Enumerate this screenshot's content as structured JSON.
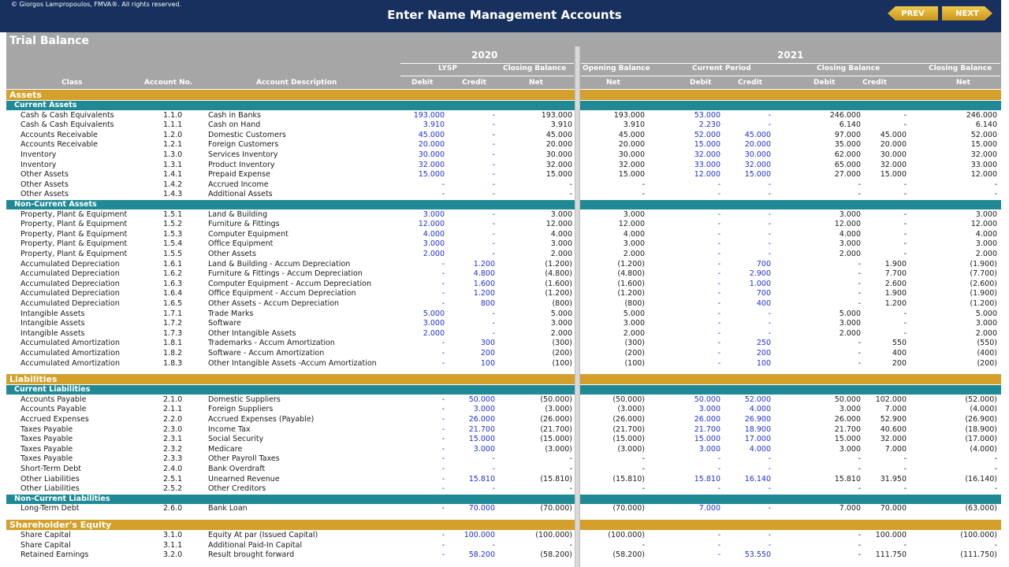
{
  "header": {
    "copyright": "© Giorgos Lampropoulos, FMVA®. All rights reserved.",
    "title": "Enter Name Management Accounts",
    "prev_label": "PREV",
    "next_label": "NEXT"
  },
  "sheet": {
    "title": "Trial Balance",
    "year_2020": "2020",
    "year_2021": "2021",
    "groups": {
      "lysp": "LYSP",
      "closing_2020": "Closing Balance",
      "opening": "Opening Balance",
      "current": "Current Period",
      "closing_2021": "Closing Balance",
      "closing_2021_net": "Closing Balance"
    },
    "columns": {
      "class": "Class",
      "account_no": "Account No.",
      "description": "Account Description",
      "debit": "Debit",
      "credit": "Credit",
      "net": "Net"
    }
  },
  "colors": {
    "navy": "#17305e",
    "gold": "#d4a02b",
    "teal": "#1f8a96",
    "grey": "#a6a6a6",
    "input_blue": "#1f2fd6"
  },
  "rows": [
    {
      "type": "section",
      "label": "Assets"
    },
    {
      "type": "sub",
      "label": "Current Assets"
    },
    {
      "cls": "Cash & Cash Equivalents",
      "no": "1.1.0",
      "desc": "Cash in Banks",
      "v": [
        "193.000",
        "-",
        "193.000",
        "193.000",
        "53.000",
        "-",
        "246.000",
        "-",
        "246.000"
      ]
    },
    {
      "cls": "Cash & Cash Equivalents",
      "no": "1.1.1",
      "desc": "Cash on Hand",
      "v": [
        "3.910",
        "-",
        "3.910",
        "3.910",
        "2.230",
        "-",
        "6.140",
        "-",
        "6.140"
      ]
    },
    {
      "cls": "Accounts Receivable",
      "no": "1.2.0",
      "desc": "Domestic Customers",
      "v": [
        "45.000",
        "-",
        "45.000",
        "45.000",
        "52.000",
        "45.000",
        "97.000",
        "45.000",
        "52.000"
      ]
    },
    {
      "cls": "Accounts Receivable",
      "no": "1.2.1",
      "desc": "Foreign Customers",
      "v": [
        "20.000",
        "-",
        "20.000",
        "20.000",
        "15.000",
        "20.000",
        "35.000",
        "20.000",
        "15.000"
      ]
    },
    {
      "cls": "Inventory",
      "no": "1.3.0",
      "desc": "Services Inventory",
      "v": [
        "30.000",
        "-",
        "30.000",
        "30.000",
        "32.000",
        "30.000",
        "62.000",
        "30.000",
        "32.000"
      ]
    },
    {
      "cls": "Inventory",
      "no": "1.3.1",
      "desc": "Product Inventory",
      "v": [
        "32.000",
        "-",
        "32.000",
        "32.000",
        "33.000",
        "32.000",
        "65.000",
        "32.000",
        "33.000"
      ]
    },
    {
      "cls": "Other Assets",
      "no": "1.4.1",
      "desc": "Prepaid Expense",
      "v": [
        "15.000",
        "-",
        "15.000",
        "15.000",
        "12.000",
        "15.000",
        "27.000",
        "15.000",
        "12.000"
      ]
    },
    {
      "cls": "Other Assets",
      "no": "1.4.2",
      "desc": "Accrued Income",
      "v": [
        "-",
        "-",
        "-",
        "-",
        "-",
        "-",
        "-",
        "-",
        "-"
      ]
    },
    {
      "cls": "Other Assets",
      "no": "1.4.3",
      "desc": "Additional Assets",
      "v": [
        "-",
        "-",
        "-",
        "-",
        "-",
        "-",
        "-",
        "-",
        "-"
      ]
    },
    {
      "type": "sub",
      "label": "Non-Current Assets"
    },
    {
      "cls": "Property, Plant & Equipment",
      "no": "1.5.1",
      "desc": "Land & Building",
      "v": [
        "3.000",
        "-",
        "3.000",
        "3.000",
        "-",
        "-",
        "3.000",
        "-",
        "3.000"
      ]
    },
    {
      "cls": "Property, Plant & Equipment",
      "no": "1.5.2",
      "desc": "Furniture & Fittings",
      "v": [
        "12.000",
        "-",
        "12.000",
        "12.000",
        "-",
        "-",
        "12.000",
        "-",
        "12.000"
      ]
    },
    {
      "cls": "Property, Plant & Equipment",
      "no": "1.5.3",
      "desc": "Computer Equipment",
      "v": [
        "4.000",
        "-",
        "4.000",
        "4.000",
        "-",
        "-",
        "4.000",
        "-",
        "4.000"
      ]
    },
    {
      "cls": "Property, Plant & Equipment",
      "no": "1.5.4",
      "desc": "Office Equipment",
      "v": [
        "3.000",
        "-",
        "3.000",
        "3.000",
        "-",
        "-",
        "3.000",
        "-",
        "3.000"
      ]
    },
    {
      "cls": "Property, Plant & Equipment",
      "no": "1.5.5",
      "desc": "Other Assets",
      "v": [
        "2.000",
        "-",
        "2.000",
        "2.000",
        "-",
        "-",
        "2.000",
        "-",
        "2.000"
      ]
    },
    {
      "cls": "Accumulated Depreciation",
      "no": "1.6.1",
      "desc": "Land & Building - Accum Depreciation",
      "v": [
        "-",
        "1.200",
        "(1.200)",
        "(1.200)",
        "-",
        "700",
        "-",
        "1.900",
        "(1.900)"
      ]
    },
    {
      "cls": "Accumulated Depreciation",
      "no": "1.6.2",
      "desc": "Furniture & Fittings - Accum Depreciation",
      "v": [
        "-",
        "4.800",
        "(4.800)",
        "(4.800)",
        "-",
        "2.900",
        "-",
        "7.700",
        "(7.700)"
      ]
    },
    {
      "cls": "Accumulated Depreciation",
      "no": "1.6.3",
      "desc": "Computer Equipment - Accum Depreciation",
      "v": [
        "-",
        "1.600",
        "(1.600)",
        "(1.600)",
        "-",
        "1.000",
        "-",
        "2.600",
        "(2.600)"
      ]
    },
    {
      "cls": "Accumulated Depreciation",
      "no": "1.6.4",
      "desc": "Office Equipment - Accum Depreciation",
      "v": [
        "-",
        "1.200",
        "(1.200)",
        "(1.200)",
        "-",
        "700",
        "-",
        "1.900",
        "(1.900)"
      ]
    },
    {
      "cls": "Accumulated Depreciation",
      "no": "1.6.5",
      "desc": "Other Assets - Accum Depreciation",
      "v": [
        "-",
        "800",
        "(800)",
        "(800)",
        "-",
        "400",
        "-",
        "1.200",
        "(1.200)"
      ]
    },
    {
      "cls": "Intangible Assets",
      "no": "1.7.1",
      "desc": "Trade Marks",
      "v": [
        "5.000",
        "-",
        "5.000",
        "5.000",
        "-",
        "-",
        "5.000",
        "-",
        "5.000"
      ]
    },
    {
      "cls": "Intangible Assets",
      "no": "1.7.2",
      "desc": "Software",
      "v": [
        "3.000",
        "-",
        "3.000",
        "3.000",
        "-",
        "-",
        "3.000",
        "-",
        "3.000"
      ]
    },
    {
      "cls": "Intangible Assets",
      "no": "1.7.3",
      "desc": "Other Intangible Assets",
      "v": [
        "2.000",
        "-",
        "2.000",
        "2.000",
        "-",
        "-",
        "2.000",
        "-",
        "2.000"
      ]
    },
    {
      "cls": "Accumulated Amortization",
      "no": "1.8.1",
      "desc": "Trademarks - Accum Amortization",
      "v": [
        "-",
        "300",
        "(300)",
        "(300)",
        "-",
        "250",
        "-",
        "550",
        "(550)"
      ]
    },
    {
      "cls": "Accumulated Amortization",
      "no": "1.8.2",
      "desc": "Software - Accum Amortization",
      "v": [
        "-",
        "200",
        "(200)",
        "(200)",
        "-",
        "200",
        "-",
        "400",
        "(400)"
      ]
    },
    {
      "cls": "Accumulated Amortization",
      "no": "1.8.3",
      "desc": "Other Intangible Assets -Accum Amortization",
      "v": [
        "-",
        "100",
        "(100)",
        "(100)",
        "-",
        "100",
        "-",
        "200",
        "(200)"
      ]
    },
    {
      "type": "gap"
    },
    {
      "type": "section",
      "label": "Liabilities"
    },
    {
      "type": "sub",
      "label": "Current Liabilities"
    },
    {
      "cls": "Accounts Payable",
      "no": "2.1.0",
      "desc": "Domestic Suppliers",
      "v": [
        "-",
        "50.000",
        "(50.000)",
        "(50.000)",
        "50.000",
        "52.000",
        "50.000",
        "102.000",
        "(52.000)"
      ]
    },
    {
      "cls": "Accounts Payable",
      "no": "2.1.1",
      "desc": "Foreign Suppliers",
      "v": [
        "-",
        "3.000",
        "(3.000)",
        "(3.000)",
        "3.000",
        "4.000",
        "3.000",
        "7.000",
        "(4.000)"
      ]
    },
    {
      "cls": "Accrued Expenses",
      "no": "2.2.0",
      "desc": "Accrued Expenses (Payable)",
      "v": [
        "-",
        "26.000",
        "(26.000)",
        "(26.000)",
        "26.000",
        "26.900",
        "26.000",
        "52.900",
        "(26.900)"
      ]
    },
    {
      "cls": "Taxes Payable",
      "no": "2.3.0",
      "desc": "Income Tax",
      "v": [
        "-",
        "21.700",
        "(21.700)",
        "(21.700)",
        "21.700",
        "18.900",
        "21.700",
        "40.600",
        "(18.900)"
      ]
    },
    {
      "cls": "Taxes Payable",
      "no": "2.3.1",
      "desc": "Social Security",
      "v": [
        "-",
        "15.000",
        "(15.000)",
        "(15.000)",
        "15.000",
        "17.000",
        "15.000",
        "32.000",
        "(17.000)"
      ]
    },
    {
      "cls": "Taxes Payable",
      "no": "2.3.2",
      "desc": "Medicare",
      "v": [
        "-",
        "3.000",
        "(3.000)",
        "(3.000)",
        "3.000",
        "4.000",
        "3.000",
        "7.000",
        "(4.000)"
      ]
    },
    {
      "cls": "Taxes Payable",
      "no": "2.3.3",
      "desc": "Other Payroll Taxes",
      "v": [
        "-",
        "-",
        "-",
        "-",
        "-",
        "-",
        "-",
        "-",
        "-"
      ]
    },
    {
      "cls": "Short-Term Debt",
      "no": "2.4.0",
      "desc": "Bank Overdraft",
      "v": [
        "-",
        "-",
        "-",
        "-",
        "-",
        "-",
        "-",
        "-",
        "-"
      ]
    },
    {
      "cls": "Other Liabilities",
      "no": "2.5.1",
      "desc": "Unearned Revenue",
      "v": [
        "-",
        "15.810",
        "(15.810)",
        "(15.810)",
        "15.810",
        "16.140",
        "15.810",
        "31.950",
        "(16.140)"
      ]
    },
    {
      "cls": "Other Liabilities",
      "no": "2.5.2",
      "desc": "Other Creditors",
      "v": [
        "-",
        "-",
        "-",
        "-",
        "-",
        "-",
        "-",
        "-",
        "-"
      ]
    },
    {
      "type": "sub",
      "label": "Non-Current Liabilities"
    },
    {
      "cls": "Long-Term Debt",
      "no": "2.6.0",
      "desc": "Bank Loan",
      "v": [
        "-",
        "70.000",
        "(70.000)",
        "(70.000)",
        "7.000",
        "-",
        "7.000",
        "70.000",
        "(63.000)"
      ]
    },
    {
      "type": "gap"
    },
    {
      "type": "section",
      "label": "Shareholder's Equity"
    },
    {
      "cls": "Share Capital",
      "no": "3.1.0",
      "desc": "Equity At par (Issued Capital)",
      "v": [
        "-",
        "100.000",
        "(100.000)",
        "(100.000)",
        "-",
        "-",
        "-",
        "100.000",
        "(100.000)"
      ]
    },
    {
      "cls": "Share Capital",
      "no": "3.1.1",
      "desc": "Additional Paid-In Capital",
      "v": [
        "-",
        "-",
        "-",
        "-",
        "-",
        "-",
        "-",
        "-",
        "-"
      ]
    },
    {
      "cls": "Retained Earnings",
      "no": "3.2.0",
      "desc": "Result brought forward",
      "v": [
        "-",
        "58.200",
        "(58.200)",
        "(58.200)",
        "-",
        "53.550",
        "-",
        "111.750",
        "(111.750)"
      ]
    }
  ]
}
